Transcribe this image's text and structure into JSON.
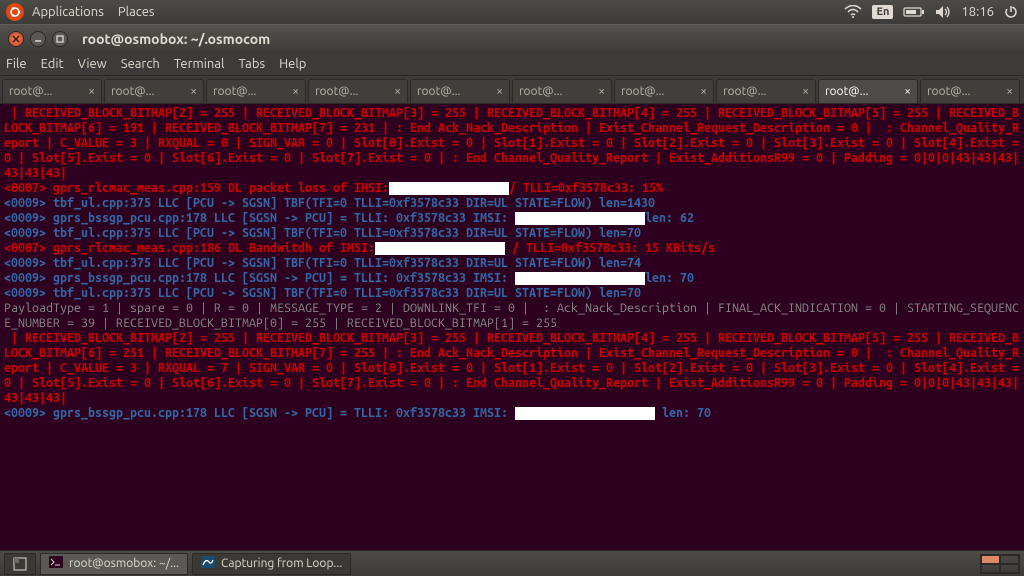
{
  "top_panel": {
    "applications": "Applications",
    "places": "Places",
    "lang": "En",
    "clock": "18:16"
  },
  "window": {
    "title": "root@osmobox: ~/.osmocom"
  },
  "menubar": {
    "file": "File",
    "edit": "Edit",
    "view": "View",
    "search": "Search",
    "terminal": "Terminal",
    "tabs": "Tabs",
    "help": "Help"
  },
  "tabs": [
    {
      "label": "root@...",
      "active": false
    },
    {
      "label": "root@...",
      "active": false
    },
    {
      "label": "root@...",
      "active": false
    },
    {
      "label": "root@...",
      "active": false
    },
    {
      "label": "root@...",
      "active": false
    },
    {
      "label": "root@...",
      "active": false
    },
    {
      "label": "root@...",
      "active": false
    },
    {
      "label": "root@...",
      "active": false
    },
    {
      "label": "root@...",
      "active": true
    },
    {
      "label": "root@...",
      "active": false
    }
  ],
  "terminal_lines": [
    {
      "cls": "red",
      "text": " | RECEIVED_BLOCK_BITMAP[2] = 255 | RECEIVED_BLOCK_BITMAP[3] = 255 | RECEIVED_BLOCK_BITMAP[4] = 255 | RECEIVED_BLOCK_BITMAP[5] = 255 | RECEIVED_BLOCK_BITMAP[6] = 191 | RECEIVED_BLOCK_BITMAP[7] = 231 | : End Ack_Nack_Description | Exist_Channel_Request_Description = 0 |  : Channel_Quality_Report | C_VALUE = 3 | RXQUAL = 0 | SIGN_VAR = 0 | Slot[0].Exist = 0 | Slot[1].Exist = 0 | Slot[2].Exist = 0 | Slot[3].Exist = 0 | Slot[4].Exist = 0 | Slot[5].Exist = 0 | Slot[6].Exist = 0 | Slot[7].Exist = 0 | : End Channel_Quality_Report | Exist_AdditionsR99 = 0 | Padding = 0|0|0|43|43|43|43|43|43|"
    },
    {
      "cls": "mix",
      "parts": [
        {
          "cls": "red",
          "text": "<0007> gprs_rlcmac_meas.cpp:159 DL packet loss of IMSI:"
        },
        {
          "cls": "redact w1",
          "text": " "
        },
        {
          "cls": "red",
          "text": "/ TLLI=0xf3578c33: 15%"
        }
      ]
    },
    {
      "cls": "blue",
      "text": "<0009> tbf_ul.cpp:375 LLC [PCU -> SGSN] TBF(TFI=0 TLLI=0xf3578c33 DIR=UL STATE=FLOW) len=1430"
    },
    {
      "cls": "mix",
      "parts": [
        {
          "cls": "blue",
          "text": "<0009> gprs_bssgp_pcu.cpp:178 LLC [SGSN -> PCU] = TLLI: 0xf3578c33 IMSI: "
        },
        {
          "cls": "redact w2",
          "text": " "
        },
        {
          "cls": "blue",
          "text": "len: 62"
        }
      ]
    },
    {
      "cls": "blue",
      "text": "<0009> tbf_ul.cpp:375 LLC [PCU -> SGSN] TBF(TFI=0 TLLI=0xf3578c33 DIR=UL STATE=FLOW) len=70"
    },
    {
      "cls": "mix",
      "parts": [
        {
          "cls": "red",
          "text": "<0007> gprs_rlcmac_meas.cpp:186 DL Bandwitdh of IMSI:"
        },
        {
          "cls": "redact w2",
          "text": " "
        },
        {
          "cls": "red",
          "text": " / TLLI=0xf3578c33: 15 KBits/s"
        }
      ]
    },
    {
      "cls": "blue",
      "text": "<0009> tbf_ul.cpp:375 LLC [PCU -> SGSN] TBF(TFI=0 TLLI=0xf3578c33 DIR=UL STATE=FLOW) len=74"
    },
    {
      "cls": "mix",
      "parts": [
        {
          "cls": "blue",
          "text": "<0009> gprs_bssgp_pcu.cpp:178 LLC [SGSN -> PCU] = TLLI: 0xf3578c33 IMSI: "
        },
        {
          "cls": "redact w2",
          "text": " "
        },
        {
          "cls": "blue",
          "text": "len: 70"
        }
      ]
    },
    {
      "cls": "blue",
      "text": "<0009> tbf_ul.cpp:375 LLC [PCU -> SGSN] TBF(TFI=0 TLLI=0xf3578c33 DIR=UL STATE=FLOW) len=70"
    },
    {
      "cls": "grey",
      "text": "PayloadType = 1 | spare = 0 | R = 0 | MESSAGE_TYPE = 2 | DOWNLINK_TFI = 0 |  : Ack_Nack_Description | FINAL_ACK_INDICATION = 0 | STARTING_SEQUENCE_NUMBER = 39 | RECEIVED_BLOCK_BITMAP[0] = 255 | RECEIVED_BLOCK_BITMAP[1] = 255"
    },
    {
      "cls": "red",
      "text": " | RECEIVED_BLOCK_BITMAP[2] = 255 | RECEIVED_BLOCK_BITMAP[3] = 255 | RECEIVED_BLOCK_BITMAP[4] = 255 | RECEIVED_BLOCK_BITMAP[5] = 255 | RECEIVED_BLOCK_BITMAP[6] = 251 | RECEIVED_BLOCK_BITMAP[7] = 255 | : End Ack_Nack_Description | Exist_Channel_Request_Description = 0 |  : Channel_Quality_Report | C_VALUE = 3 | RXQUAL = 7 | SIGN_VAR = 0 | Slot[0].Exist = 0 | Slot[1].Exist = 0 | Slot[2].Exist = 0 | Slot[3].Exist = 0 | Slot[4].Exist = 0 | Slot[5].Exist = 0 | Slot[6].Exist = 0 | Slot[7].Exist = 0 | : End Channel_Quality_Report | Exist_AdditionsR99 = 0 | Padding = 0|0|0|43|43|43|43|43|43|"
    },
    {
      "cls": "mix",
      "parts": [
        {
          "cls": "blue",
          "text": "<0009> gprs_bssgp_pcu.cpp:178 LLC [SGSN -> PCU] = TLLI: 0xf3578c33 IMSI: "
        },
        {
          "cls": "redact w3",
          "text": " "
        },
        {
          "cls": "blue",
          "text": " len: 70"
        }
      ]
    }
  ],
  "bottom_panel": {
    "task1": "root@osmobox: ~/...",
    "task2": "Capturing from Loop..."
  }
}
